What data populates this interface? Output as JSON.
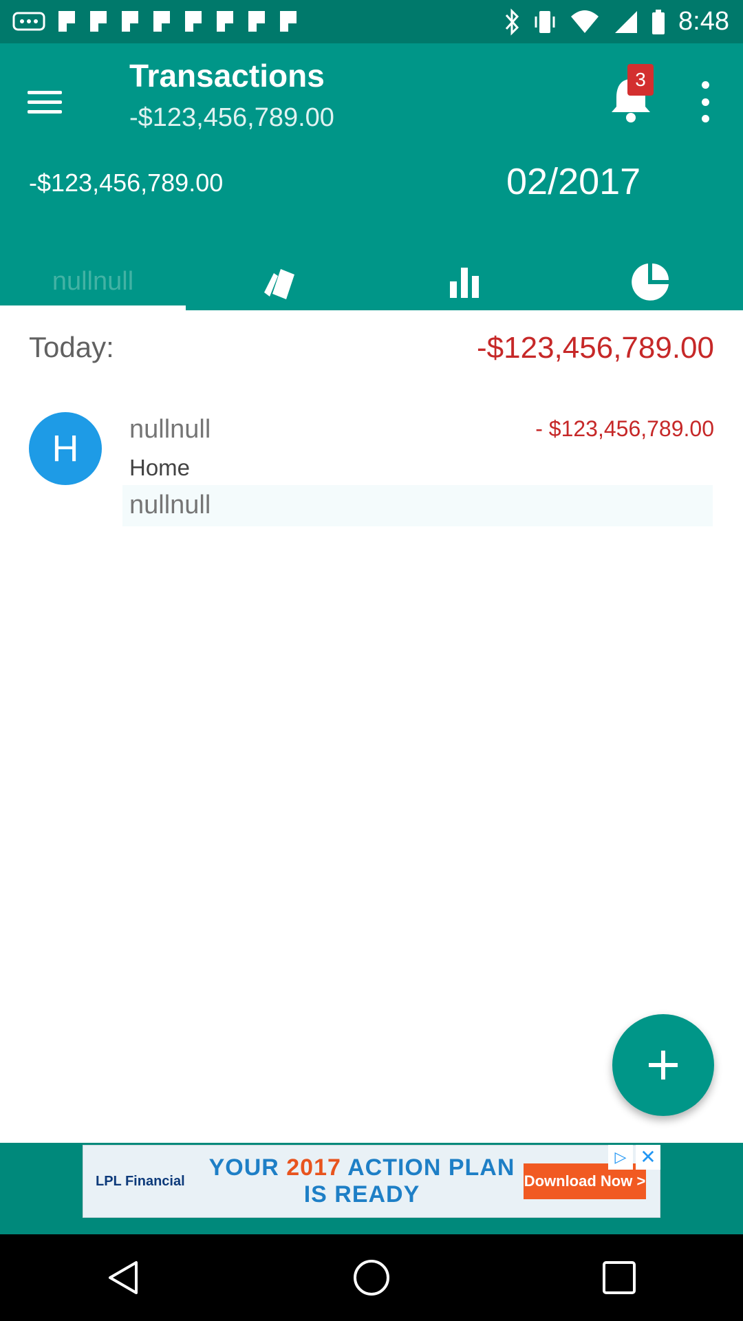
{
  "status_bar": {
    "time": "8:48",
    "icons": [
      "more-dots-icon",
      "flag-icon",
      "flag-icon",
      "flag-icon",
      "flag-icon",
      "flag-icon",
      "flag-icon",
      "flag-icon",
      "flag-icon",
      "bluetooth-icon",
      "vibrate-icon",
      "wifi-icon",
      "signal-icon",
      "battery-icon"
    ]
  },
  "header": {
    "title": "Transactions",
    "subtitle": "-$123,456,789.00",
    "notification_count": "3",
    "balance": "-$123,456,789.00",
    "month": "02/2017"
  },
  "tabs": [
    {
      "label": "nullnull",
      "icon": null
    },
    {
      "label": "",
      "icon": "cards-icon"
    },
    {
      "label": "",
      "icon": "bar-chart-icon"
    },
    {
      "label": "",
      "icon": "pie-chart-icon"
    }
  ],
  "summary": {
    "label": "Today:",
    "amount": "-$123,456,789.00"
  },
  "transaction": {
    "avatar_letter": "H",
    "title": "nullnull",
    "amount": "- $123,456,789.00",
    "category": "Home",
    "note": "nullnull"
  },
  "ad": {
    "brand": "LPL Financial",
    "headline_a": "YOUR ",
    "headline_year": "2017",
    "headline_b": " ACTION PLAN IS READY",
    "cta": "Download Now >"
  },
  "colors": {
    "primary": "#009688",
    "primary_dark": "#00796b",
    "negative": "#c62828",
    "avatar": "#1e9be6",
    "badge": "#d32f2f"
  }
}
